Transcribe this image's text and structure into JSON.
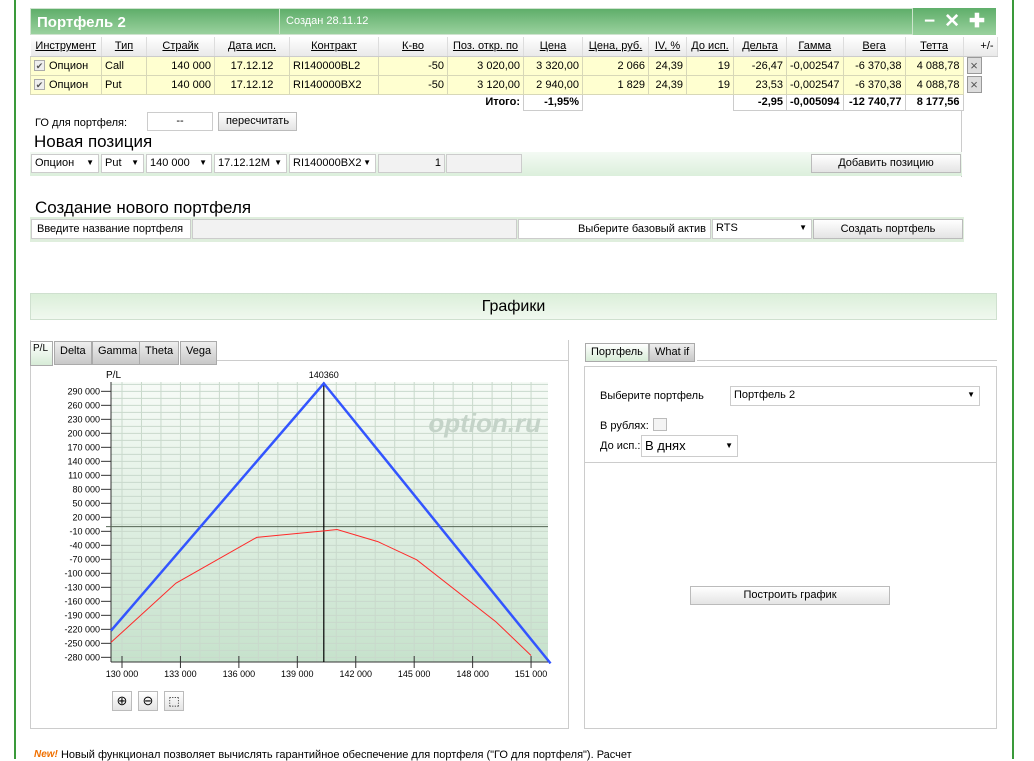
{
  "portfolio": {
    "title": "Портфель 2",
    "created": "Создан 28.11.12",
    "controls": {
      "minimize": "−",
      "close": "✕",
      "add": "✚"
    },
    "columns": [
      "Инструмент",
      "Тип",
      "Страйк",
      "Дата исп.",
      "Контракт",
      "К-во",
      "Поз. откр. по",
      "Цена",
      "Цена, руб.",
      "IV, %",
      "До исп.",
      "Дельта",
      "Гамма",
      "Вега",
      "Тетта",
      "+/-"
    ],
    "rows": [
      {
        "checked": true,
        "instrument": "Опцион",
        "type": "Call",
        "strike": "140 000",
        "date": "17.12.12",
        "contract": "RI140000BL2",
        "qty": "-50",
        "open": "3 020,00",
        "price": "3 320,00",
        "price_rub": "2 066",
        "iv": "24,39",
        "days": "19",
        "delta": "-26,47",
        "gamma": "-0,002547",
        "vega": "-6 370,38",
        "theta": "4 088,78"
      },
      {
        "checked": true,
        "instrument": "Опцион",
        "type": "Put",
        "strike": "140 000",
        "date": "17.12.12",
        "contract": "RI140000BX2",
        "qty": "-50",
        "open": "3 120,00",
        "price": "2 940,00",
        "price_rub": "1 829",
        "iv": "24,39",
        "days": "19",
        "delta": "23,53",
        "gamma": "-0,002547",
        "vega": "-6 370,38",
        "theta": "4 088,78"
      }
    ],
    "totals": {
      "label": "Итого:",
      "price": "-1,95%",
      "delta": "-2,95",
      "gamma": "-0,005094",
      "vega": "-12 740,77",
      "theta": "8 177,56"
    },
    "go_label": "ГО для портфеля:",
    "go_value": "--",
    "recalc": "пересчитать"
  },
  "new_position": {
    "title": "Новая позиция",
    "instrument": "Опцион",
    "type": "Put",
    "strike": "140 000",
    "date": "17.12.12M",
    "contract": "RI140000BX2",
    "qty": "1",
    "add": "Добавить позицию"
  },
  "create": {
    "title": "Создание нового портфеля",
    "name_label": "Введите название портфеля",
    "name_value": "",
    "asset_label": "Выберите базовый актив",
    "asset": "RTS",
    "button": "Создать портфель"
  },
  "graphs": {
    "title": "Графики",
    "tabs": [
      "P/L",
      "Delta",
      "Gamma",
      "Theta",
      "Vega"
    ],
    "watermark": "option.ru"
  },
  "side": {
    "tabs": [
      "Портфель",
      "What if"
    ],
    "choose_label": "Выберите портфель",
    "portfolio": "Портфель 2",
    "rub_label": "В рублях:",
    "rub_checked": false,
    "exp_label": "До исп.:",
    "exp_value": "В днях",
    "build": "Построить график"
  },
  "footer": {
    "new": "New!",
    "text": "Новый функционал позволяет вычислять гарантийное обеспечение для портфеля (\"ГО для портфеля\"). Расчет"
  },
  "colors": {
    "header_green": "#5fae6a",
    "row_yellow": "#ffffd0",
    "expiry_line": "#3355ff",
    "current_line": "#ff2a2a"
  },
  "chart_data": {
    "type": "line",
    "ylabel": "P/L",
    "marker_label": "140360",
    "marker_x": 140360,
    "xlim": [
      129435,
      151870
    ],
    "ylim": [
      -290000,
      310000
    ],
    "xticks": [
      130000,
      133000,
      136000,
      139000,
      142000,
      145000,
      148000,
      151000
    ],
    "xtick_labels": [
      "130 000",
      "133 000",
      "136 000",
      "139 000",
      "142 000",
      "145 000",
      "148 000",
      "151 000"
    ],
    "yticks": [
      290000,
      260000,
      230000,
      200000,
      170000,
      140000,
      110000,
      80000,
      50000,
      20000,
      -10000,
      -40000,
      -70000,
      -100000,
      -130000,
      -160000,
      -190000,
      -220000,
      -250000,
      -280000
    ],
    "ytick_labels": [
      "290 000",
      "260 000",
      "230 000",
      "200 000",
      "170 000",
      "140 000",
      "110 000",
      "80 000",
      "50 000",
      "20 000",
      "-10 000",
      "-40 000",
      "-70 000",
      "-100 000",
      "-130 000",
      "-160 000",
      "-190 000",
      "-220 000",
      "-250 000",
      "-280 000"
    ],
    "grid": true,
    "series": [
      {
        "color": "#3355ff",
        "x": [
          129435,
          140360,
          152000
        ],
        "y": [
          -223000,
          307000,
          -293000
        ]
      },
      {
        "color": "#ff2a2a",
        "x": [
          129435,
          132770,
          136915,
          140370,
          141040,
          143130,
          145130,
          149200,
          151000
        ],
        "y": [
          -248000,
          -121000,
          -23000,
          -9000,
          -6000,
          -32000,
          -71000,
          -204000,
          -276000
        ]
      }
    ]
  }
}
